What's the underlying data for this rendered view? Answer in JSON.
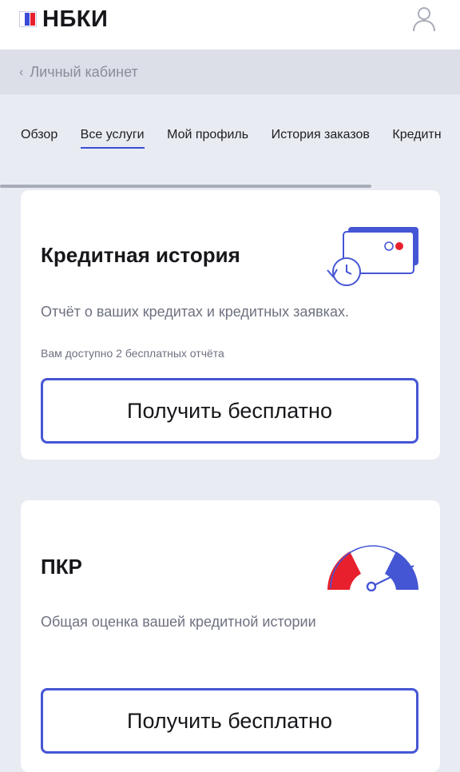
{
  "header": {
    "logo_text": "НБКИ",
    "logo_icon": "flag-logo-icon",
    "user_icon": "user-icon"
  },
  "breadcrumb": {
    "icon": "chevron-left-icon",
    "label": "Личный кабинет"
  },
  "tabs": [
    {
      "label": "Обзор",
      "active": false
    },
    {
      "label": "Все услуги",
      "active": true
    },
    {
      "label": "Мой профиль",
      "active": false
    },
    {
      "label": "История заказов",
      "active": false
    },
    {
      "label": "Кредитн",
      "active": false
    }
  ],
  "cards": [
    {
      "title": "Кредитная история",
      "description": "Отчёт о ваших кредитах и кредитных заявках.",
      "note": "Вам доступно 2 бесплатных отчёта",
      "button_label": "Получить бесплатно",
      "illustration": "credit-card-history-icon"
    },
    {
      "title": "ПКР",
      "description": "Общая оценка вашей кредитной истории",
      "button_label": "Получить бесплатно",
      "illustration": "gauge-icon"
    }
  ],
  "colors": {
    "accent": "#4556d4",
    "red": "#e8202e",
    "background": "#e9ebf3",
    "muted_text": "#6e7180"
  }
}
